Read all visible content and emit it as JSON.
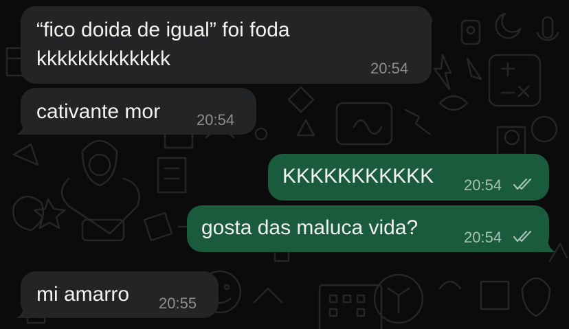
{
  "colors": {
    "background": "#0b0b0b",
    "incoming_bubble": "#232425",
    "outgoing_bubble": "#1a5a3d",
    "text": "#f2f2f2",
    "incoming_time": "#8c8e90",
    "outgoing_time": "#a4c3b2",
    "read_ticks": "#a4c3b2"
  },
  "messages": [
    {
      "direction": "incoming",
      "lines": [
        "“fico doida de igual” foi foda",
        "kkkkkkkkkkkkk"
      ],
      "time": "20:54"
    },
    {
      "direction": "incoming",
      "lines": [
        "cativante mor"
      ],
      "time": "20:54"
    },
    {
      "direction": "outgoing",
      "lines": [
        "KKKKKKKKKKK"
      ],
      "time": "20:54",
      "status_icon": "double-check-read-icon"
    },
    {
      "direction": "outgoing",
      "lines": [
        "gosta das maluca vida?"
      ],
      "time": "20:54",
      "status_icon": "double-check-read-icon"
    },
    {
      "direction": "incoming",
      "lines": [
        "mi amarro"
      ],
      "time": "20:55"
    }
  ]
}
